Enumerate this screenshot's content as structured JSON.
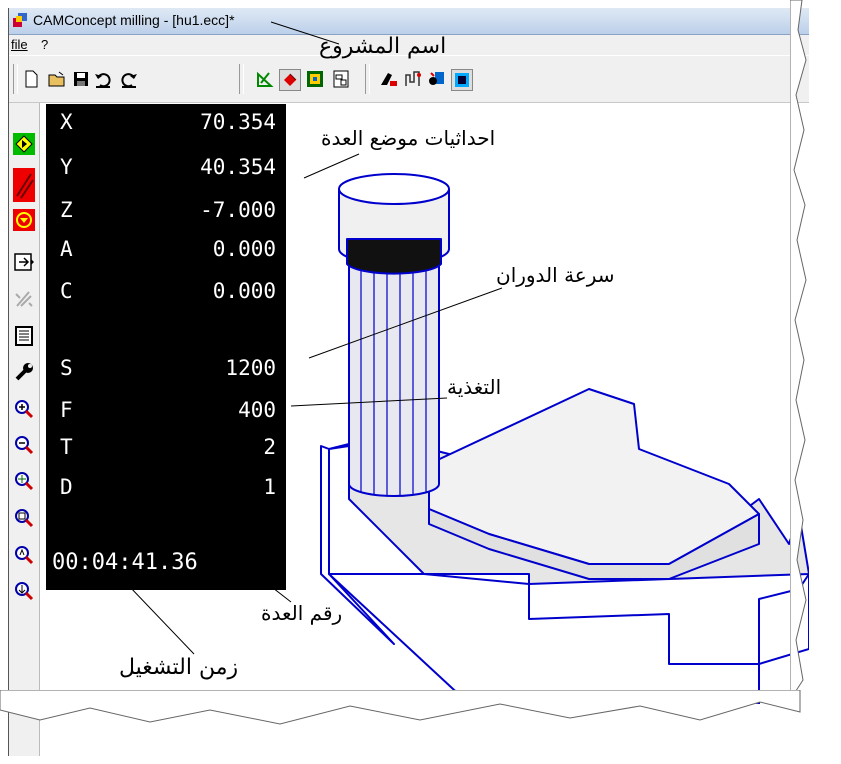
{
  "window": {
    "title": "CAMConcept milling - [hu1.ecc]*"
  },
  "menu": {
    "items": [
      "file",
      "?"
    ]
  },
  "toolbar": {
    "buttons": [
      "new-file-icon",
      "open-folder-icon",
      "save-icon",
      "undo-icon",
      "redo-icon",
      "toolpath-icon",
      "simulate-icon",
      "machine-view-icon",
      "sheet-icon",
      "tool-table-icon",
      "path-edit-icon",
      "machine-icon",
      "control-panel-icon"
    ]
  },
  "sidebar": {
    "buttons": [
      "cycle-start-icon",
      "feed-hold-icon",
      "stop-icon",
      "single-step-icon",
      "skip-icon",
      "program-list-icon",
      "tool-icon",
      "zoom-in-icon",
      "zoom-out-icon",
      "zoom-fit-icon",
      "zoom-window-icon",
      "zoom-prev-icon",
      "zoom-all-icon"
    ]
  },
  "dro": {
    "rows": [
      {
        "axis": "X",
        "value": "70.354"
      },
      {
        "axis": "Y",
        "value": "40.354"
      },
      {
        "axis": "Z",
        "value": "-7.000"
      },
      {
        "axis": "A",
        "value": "0.000"
      },
      {
        "axis": "C",
        "value": "0.000"
      },
      {
        "axis": "S",
        "value": "1200"
      },
      {
        "axis": "F",
        "value": "400"
      },
      {
        "axis": "T",
        "value": "2"
      },
      {
        "axis": "D",
        "value": "1"
      }
    ],
    "time": "00:04:41.36"
  },
  "annotations": {
    "project_name": "اسم المشروع",
    "tool_coordinates": "احداثيات موضع العدة",
    "spindle_speed": "سرعة الدوران",
    "feed": "التغذية",
    "tool_number": "رقم العدة",
    "run_time": "زمن التشغيل"
  },
  "colors": {
    "dro_bg": "#000000",
    "dro_text": "#ffffff",
    "model_line": "#0000cc",
    "model_top": "#f2f2f2",
    "model_side": "#d0d0d0"
  }
}
